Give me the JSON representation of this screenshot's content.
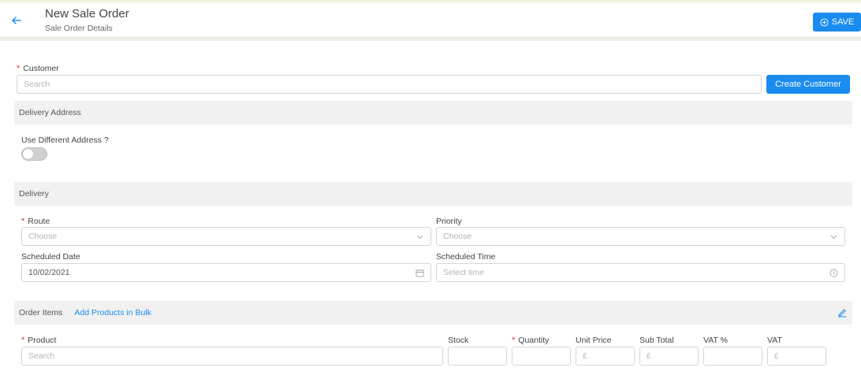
{
  "header": {
    "title": "New Sale Order",
    "subtitle": "Sale Order Details",
    "save_label": "SAVE"
  },
  "customer": {
    "label": "Customer",
    "required_mark": "*",
    "search_placeholder": "Search",
    "create_button": "Create Customer"
  },
  "delivery_address": {
    "section_title": "Delivery Address",
    "toggle_label": "Use Different Address ?",
    "toggle_on": false
  },
  "delivery": {
    "section_title": "Delivery",
    "route": {
      "label": "Route",
      "placeholder": "Choose"
    },
    "priority": {
      "label": "Priority",
      "placeholder": "Choose"
    },
    "scheduled_date": {
      "label": "Scheduled Date",
      "value": "10/02/2021"
    },
    "scheduled_time": {
      "label": "Scheduled Time",
      "placeholder": "Select time"
    }
  },
  "order_items": {
    "section_title": "Order Items",
    "bulk_link": "Add Products in Bulk",
    "columns": {
      "product": "Product",
      "stock": "Stock",
      "quantity": "Quantity",
      "unit_price": "Unit Price",
      "sub_total": "Sub Total",
      "vat_percent": "VAT %",
      "vat": "VAT"
    },
    "row": {
      "product_placeholder": "Search",
      "currency": "£"
    }
  },
  "colors": {
    "accent": "#1a8cf0",
    "required": "#e0392d",
    "section_bg": "#f1f1f1"
  }
}
